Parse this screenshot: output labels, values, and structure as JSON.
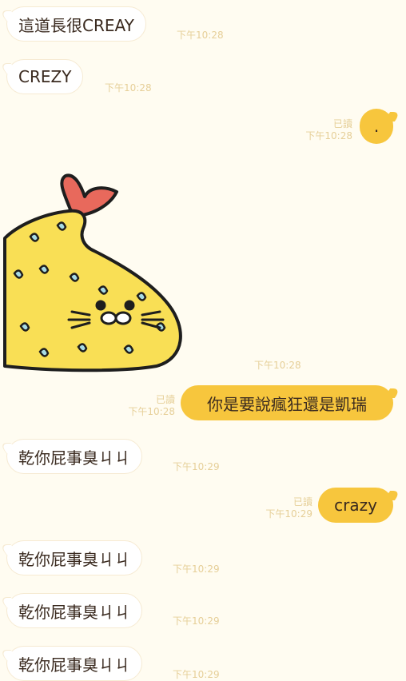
{
  "messages": [
    {
      "text": "這道長很CREAY",
      "time": "下午10:28"
    },
    {
      "text": "CREZY",
      "time": "下午10:28"
    },
    {
      "text": ".",
      "read": "已讀",
      "time": "下午10:28"
    },
    {
      "sticker": "fried-shrimp-seal-sticker",
      "time": "下午10:28"
    },
    {
      "text": "你是要說瘋狂還是凱瑞",
      "read": "已讀",
      "time": "下午10:28"
    },
    {
      "text": "乾你屁事臭ㄐㄐ",
      "time": "下午10:29"
    },
    {
      "text": "crazy",
      "read": "已讀",
      "time": "下午10:29"
    },
    {
      "text": "乾你屁事臭ㄐㄐ",
      "time": "下午10:29"
    },
    {
      "text": "乾你屁事臭ㄐㄐ",
      "time": "下午10:29"
    },
    {
      "text": "乾你屁事臭ㄐㄐ",
      "time": "下午10:29"
    }
  ],
  "colors": {
    "background": "#fffcf1",
    "outgoing_bubble": "#f7c63d",
    "incoming_bubble": "#ffffff",
    "meta_text": "#e6cf98"
  }
}
